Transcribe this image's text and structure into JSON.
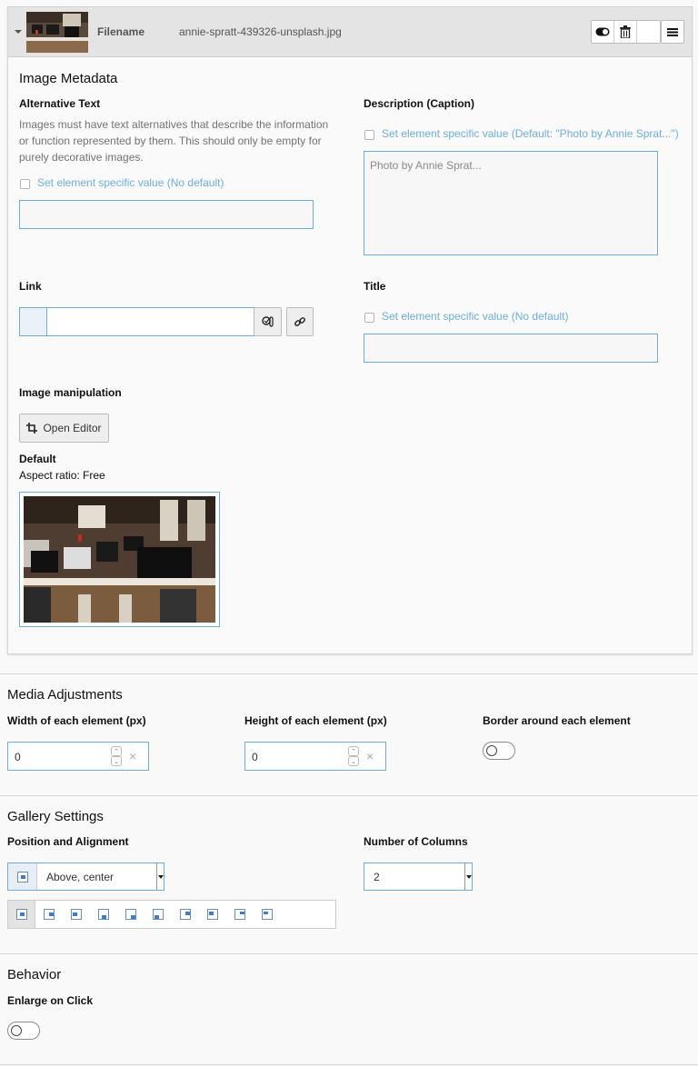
{
  "file_header": {
    "filename_label": "Filename",
    "filename_value": "annie-spratt-439326-unsplash.jpg",
    "actions": [
      "toggle-visibility-icon",
      "trash-icon",
      "blank",
      "hamburger-icon"
    ]
  },
  "metadata": {
    "title": "Image Metadata",
    "alt_text": {
      "label": "Alternative Text",
      "help": "Images must have text alternatives that describe the information or function represented by them. This should only be empty for purely decorative images.",
      "checkbox_label": "Set element specific value (No default)",
      "value": ""
    },
    "description": {
      "label": "Description (Caption)",
      "checkbox_label": "Set element specific value (Default: \"Photo by Annie Sprat...\")",
      "value": "Photo by Annie Sprat..."
    },
    "link": {
      "label": "Link",
      "value": ""
    },
    "title_field": {
      "label": "Title",
      "checkbox_label": "Set element specific value (No default)",
      "value": ""
    },
    "image_manipulation": {
      "label": "Image manipulation",
      "open_editor": "Open Editor",
      "variant_title": "Default",
      "aspect_ratio": "Aspect ratio: Free"
    }
  },
  "media_adjustments": {
    "title": "Media Adjustments",
    "width": {
      "label": "Width of each element (px)",
      "value": "0"
    },
    "height": {
      "label": "Height of each element (px)",
      "value": "0"
    },
    "border": {
      "label": "Border around each element",
      "on": false
    }
  },
  "gallery_settings": {
    "title": "Gallery Settings",
    "position": {
      "label": "Position and Alignment",
      "selected": "Above, center"
    },
    "columns": {
      "label": "Number of Columns",
      "selected": "2"
    }
  },
  "behavior": {
    "title": "Behavior",
    "enlarge": {
      "label": "Enlarge on Click",
      "on": false
    }
  },
  "colors": {
    "accent": "#6daee0",
    "link_text": "#6daee0"
  }
}
